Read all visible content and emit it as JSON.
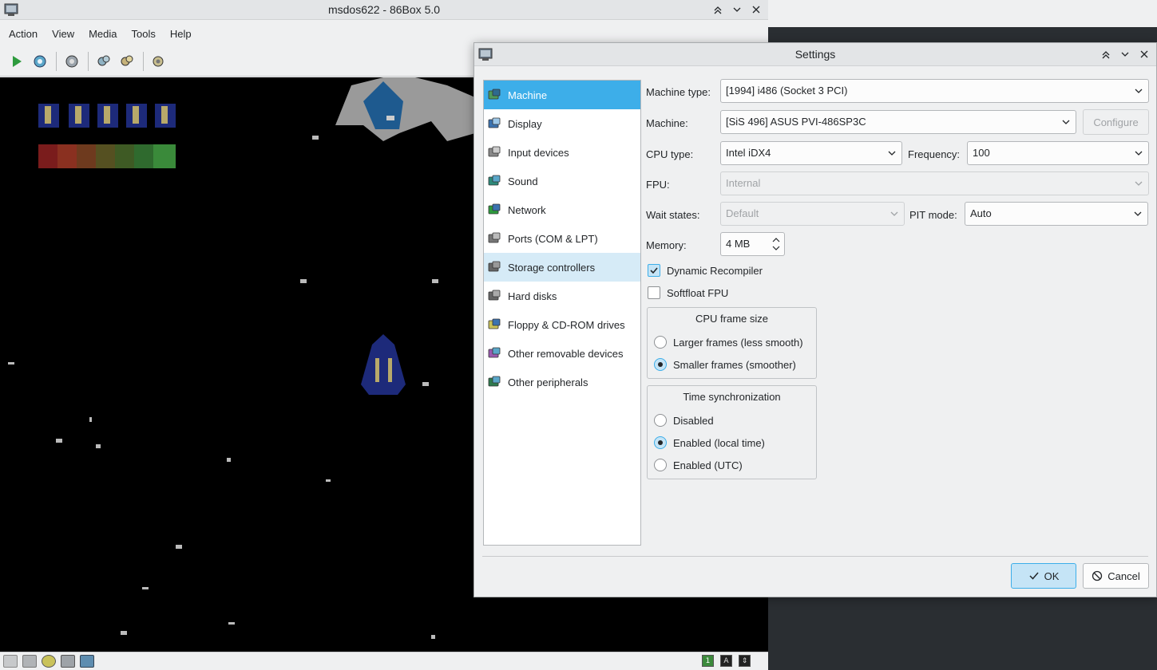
{
  "main_window": {
    "title": "msdos622 - 86Box 5.0",
    "menu": [
      "Action",
      "View",
      "Media",
      "Tools",
      "Help"
    ],
    "toolbar_icons": [
      "play-icon",
      "reset-icon",
      "ctrl-alt-del-icon",
      "pause-icon",
      "settings-icon",
      "hard-reset-icon"
    ],
    "status_indicators": [
      "1",
      "A",
      "⇕"
    ]
  },
  "settings": {
    "title": "Settings",
    "nav": [
      {
        "label": "Machine",
        "icon": "machine-icon",
        "state": "selected"
      },
      {
        "label": "Display",
        "icon": "display-icon",
        "state": ""
      },
      {
        "label": "Input devices",
        "icon": "input-devices-icon",
        "state": ""
      },
      {
        "label": "Sound",
        "icon": "sound-icon",
        "state": ""
      },
      {
        "label": "Network",
        "icon": "network-icon",
        "state": ""
      },
      {
        "label": "Ports (COM & LPT)",
        "icon": "ports-icon",
        "state": ""
      },
      {
        "label": "Storage controllers",
        "icon": "storage-controllers-icon",
        "state": "hover"
      },
      {
        "label": "Hard disks",
        "icon": "hard-disk-icon",
        "state": ""
      },
      {
        "label": "Floppy & CD-ROM drives",
        "icon": "floppy-cdrom-icon",
        "state": ""
      },
      {
        "label": "Other removable devices",
        "icon": "removable-devices-icon",
        "state": ""
      },
      {
        "label": "Other peripherals",
        "icon": "peripherals-icon",
        "state": ""
      }
    ],
    "machine_type": {
      "label": "Machine type:",
      "value": "[1994] i486 (Socket 3 PCI)"
    },
    "machine": {
      "label": "Machine:",
      "value": "[SiS 496] ASUS PVI-486SP3C",
      "configure": "Configure"
    },
    "cpu_type": {
      "label": "CPU type:",
      "value": "Intel iDX4"
    },
    "frequency": {
      "label": "Frequency:",
      "value": "100"
    },
    "fpu": {
      "label": "FPU:",
      "value": "Internal"
    },
    "wait_states": {
      "label": "Wait states:",
      "value": "Default"
    },
    "pit_mode": {
      "label": "PIT mode:",
      "value": "Auto"
    },
    "memory": {
      "label": "Memory:",
      "value": "4 MB"
    },
    "dynamic_recompiler": {
      "label": "Dynamic Recompiler",
      "checked": true
    },
    "softfloat_fpu": {
      "label": "Softfloat FPU",
      "checked": false
    },
    "cpu_frame_size": {
      "title": "CPU frame size",
      "options": [
        "Larger frames (less smooth)",
        "Smaller frames (smoother)"
      ],
      "selected": 1
    },
    "time_sync": {
      "title": "Time synchronization",
      "options": [
        "Disabled",
        "Enabled (local time)",
        "Enabled (UTC)"
      ],
      "selected": 1
    },
    "ok": "OK",
    "cancel": "Cancel"
  },
  "colors": {
    "accent": "#3daee9",
    "window_bg": "#eff0f1"
  }
}
